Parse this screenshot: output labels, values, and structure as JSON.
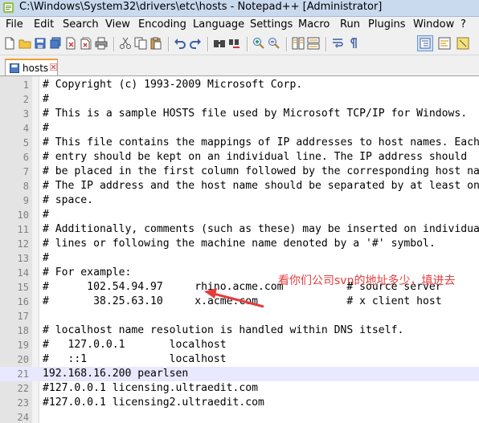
{
  "window": {
    "title": "C:\\Windows\\System32\\drivers\\etc\\hosts - Notepad++ [Administrator]"
  },
  "menu": [
    "File",
    "Edit",
    "Search",
    "View",
    "Encoding",
    "Language",
    "Settings",
    "Macro",
    "Run",
    "Plugins",
    "Window",
    "?"
  ],
  "tab": {
    "label": "hosts"
  },
  "lines": [
    {
      "n": "1",
      "text": "# Copyright (c) 1993-2009 Microsoft Corp."
    },
    {
      "n": "2",
      "text": "#"
    },
    {
      "n": "3",
      "text": "# This is a sample HOSTS file used by Microsoft TCP/IP for Windows."
    },
    {
      "n": "4",
      "text": "#"
    },
    {
      "n": "5",
      "text": "# This file contains the mappings of IP addresses to host names. Each"
    },
    {
      "n": "6",
      "text": "# entry should be kept on an individual line. The IP address should"
    },
    {
      "n": "7",
      "text": "# be placed in the first column followed by the corresponding host name."
    },
    {
      "n": "8",
      "text": "# The IP address and the host name should be separated by at least one"
    },
    {
      "n": "9",
      "text": "# space."
    },
    {
      "n": "10",
      "text": "#"
    },
    {
      "n": "11",
      "text": "# Additionally, comments (such as these) may be inserted on individual"
    },
    {
      "n": "12",
      "text": "# lines or following the machine name denoted by a '#' symbol."
    },
    {
      "n": "13",
      "text": "#"
    },
    {
      "n": "14",
      "text": "# For example:"
    },
    {
      "n": "15",
      "text": "#      102.54.94.97     rhino.acme.com          # source server"
    },
    {
      "n": "16",
      "text": "#       38.25.63.10     x.acme.com              # x client host"
    },
    {
      "n": "17",
      "text": ""
    },
    {
      "n": "18",
      "text": "# localhost name resolution is handled within DNS itself."
    },
    {
      "n": "19",
      "text": "#   127.0.0.1       localhost"
    },
    {
      "n": "20",
      "text": "#   ::1             localhost"
    },
    {
      "n": "21",
      "text": "192.168.16.200 pearlsen"
    },
    {
      "n": "22",
      "text": "#127.0.0.1 licensing.ultraedit.com"
    },
    {
      "n": "23",
      "text": "#127.0.0.1 licensing2.ultraedit.com"
    },
    {
      "n": "24",
      "text": ""
    }
  ],
  "annotation": {
    "text": "看你们公司svn的地址多少，填进去"
  },
  "colors": {
    "annotation": "#e43c3c",
    "current_line": "#e8e8ff",
    "tab_accent": "#f0a030"
  }
}
